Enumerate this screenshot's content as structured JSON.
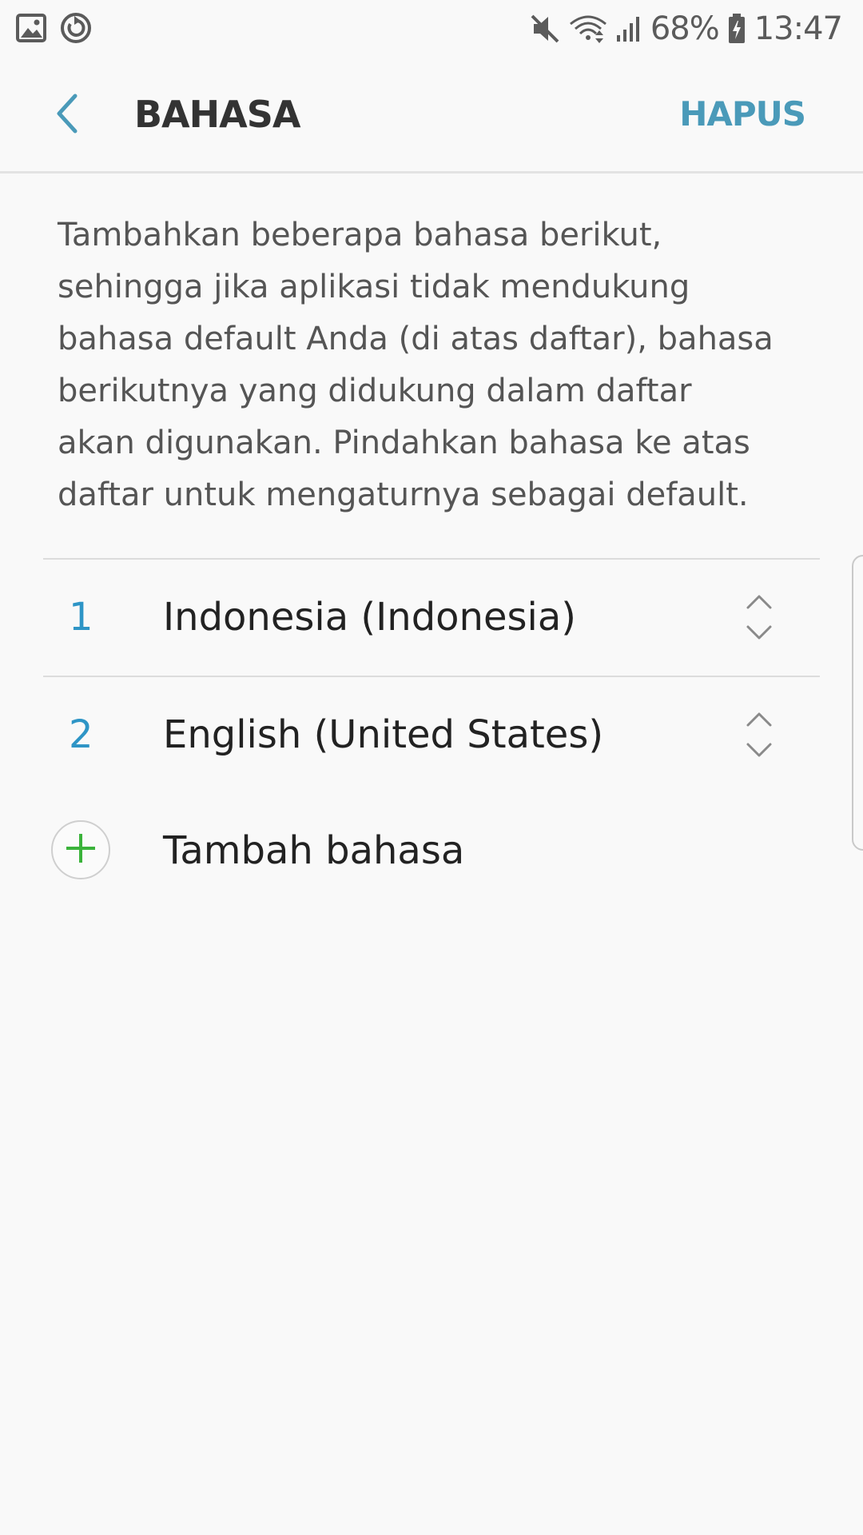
{
  "status_bar": {
    "icons_left": [
      "gallery-icon",
      "sync-icon"
    ],
    "icons_right": [
      "mute-icon",
      "wifi-icon",
      "signal-icon",
      "battery-icon"
    ],
    "battery_percent": "68%",
    "time": "13:47"
  },
  "app_bar": {
    "title": "BAHASA",
    "action_label": "HAPUS",
    "back_icon": "chevron-left-icon"
  },
  "description": "Tambahkan beberapa bahasa berikut, sehingga jika aplikasi tidak mendukung bahasa default Anda (di atas daftar), bahasa berikutnya yang didukung dalam daftar akan digunakan. Pindahkan bahasa ke atas daftar untuk mengaturnya sebagai default.",
  "languages": [
    {
      "number": "1",
      "name": "Indonesia (Indonesia)"
    },
    {
      "number": "2",
      "name": "English (United States)"
    }
  ],
  "add_language": {
    "label": "Tambah bahasa",
    "icon": "plus-icon"
  },
  "colors": {
    "accent": "#4a9ab9",
    "number": "#2e95c6",
    "add_plus": "#3bb33b",
    "background": "#f9f9f9"
  }
}
